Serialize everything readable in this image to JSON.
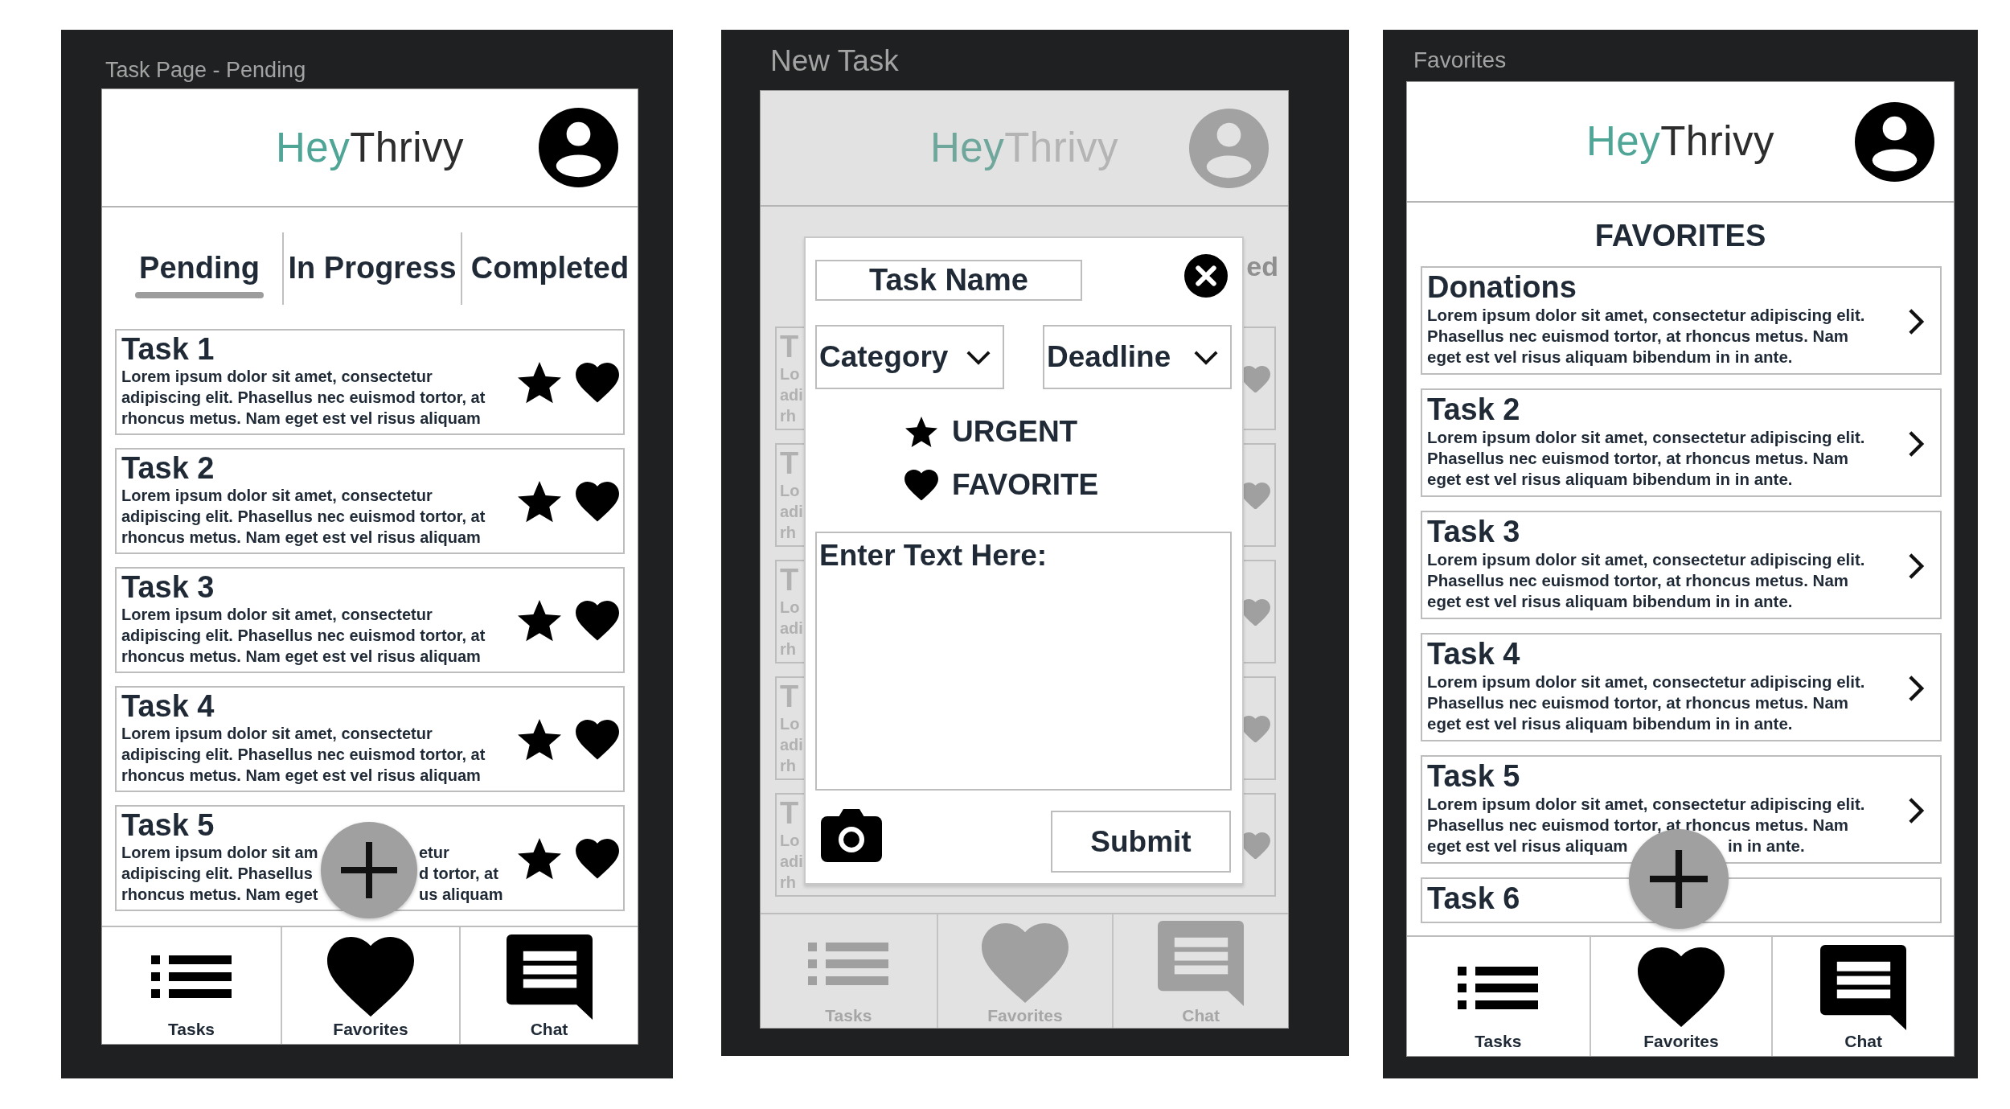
{
  "screens": [
    {
      "kind": "task_list",
      "title": "Task Page - Pending",
      "logo": {
        "lead": "Hey",
        "rest": "Thrivy"
      },
      "tabs": [
        {
          "label": "Pending",
          "selected": true
        },
        {
          "label": "In Progress",
          "selected": false
        },
        {
          "label": "Completed",
          "selected": false
        }
      ],
      "tasks": [
        {
          "title": "Task 1",
          "description": "Lorem ipsum dolor sit amet, consectetur\nadipiscing elit. Phasellus nec euismod tortor, at\nrhoncus metus. Nam eget est vel risus aliquam"
        },
        {
          "title": "Task 2",
          "description": "Lorem ipsum dolor sit amet, consectetur\nadipiscing elit. Phasellus nec euismod tortor, at\nrhoncus metus. Nam eget est vel risus aliquam"
        },
        {
          "title": "Task 3",
          "description": "Lorem ipsum dolor sit amet, consectetur\nadipiscing elit. Phasellus nec euismod tortor, at\nrhoncus metus. Nam eget est vel risus aliquam"
        },
        {
          "title": "Task 4",
          "description": "Lorem ipsum dolor sit amet, consectetur\nadipiscing elit. Phasellus nec euismod tortor, at\nrhoncus metus. Nam eget est vel risus aliquam"
        },
        {
          "title": "Task 5",
          "lines": [
            [
              "Lorem ipsum dolor sit am",
              "etur"
            ],
            [
              "adipiscing elit. Phasellus",
              "d tortor, at"
            ],
            [
              "rhoncus metus. Nam eget",
              "us aliquam"
            ]
          ]
        }
      ],
      "nav": [
        "Tasks",
        "Favorites",
        "Chat"
      ]
    },
    {
      "kind": "new_task",
      "title": "New Task",
      "logo": {
        "lead": "Hey",
        "rest": "Thrivy"
      },
      "tab_fragment": "ed",
      "cards": [
        {
          "title": "T",
          "lines": [
            "Lo",
            "adi",
            "rh"
          ]
        },
        {
          "title": "T",
          "lines": [
            "Lo",
            "adi",
            "rh"
          ]
        },
        {
          "title": "T",
          "lines": [
            "Lo",
            "adi",
            "rh"
          ]
        },
        {
          "title": "T",
          "lines": [
            "Lo",
            "adi",
            "rh"
          ]
        },
        {
          "title": "T",
          "lines": [
            "Lo",
            "adi",
            "rh"
          ]
        }
      ],
      "nav": [
        "Tasks",
        "Favorites",
        "Chat"
      ],
      "dialog": {
        "name_placeholder": "Task Name",
        "category": "Category",
        "deadline": "Deadline",
        "flags": [
          "URGENT",
          "FAVORITE"
        ],
        "text_placeholder": "Enter Text Here:",
        "submit": "Submit"
      }
    },
    {
      "kind": "favorites",
      "title": "Favorites",
      "logo": {
        "lead": "Hey",
        "rest": "Thrivy"
      },
      "heading": "FAVORITES",
      "items": [
        {
          "title": "Donations",
          "description": "Lorem ipsum dolor sit amet, consectetur adipiscing elit.\nPhasellus nec euismod tortor, at rhoncus metus. Nam\neget est vel risus aliquam bibendum in in ante."
        },
        {
          "title": "Task 2",
          "description": "Lorem ipsum dolor sit amet, consectetur adipiscing elit.\nPhasellus nec euismod tortor, at rhoncus metus. Nam\neget est vel risus aliquam bibendum in in ante."
        },
        {
          "title": "Task 3",
          "description": "Lorem ipsum dolor sit amet, consectetur adipiscing elit.\nPhasellus nec euismod tortor, at rhoncus metus. Nam\neget est vel risus aliquam bibendum in in ante."
        },
        {
          "title": "Task 4",
          "description": "Lorem ipsum dolor sit amet, consectetur adipiscing elit.\nPhasellus nec euismod tortor, at rhoncus metus. Nam\neget est vel risus aliquam bibendum in in ante."
        },
        {
          "title": "Task 5",
          "lines": [
            [
              "Lorem ipsum dolor sit amet, consectetur adipiscing elit."
            ],
            [
              "Phasellus nec euismod tortor, at rhoncus metus. Nam"
            ],
            [
              "eget est vel risus aliquam",
              "in in ante."
            ]
          ]
        },
        {
          "title": "Task 6"
        }
      ],
      "nav": [
        "Tasks",
        "Favorites",
        "Chat"
      ]
    }
  ]
}
